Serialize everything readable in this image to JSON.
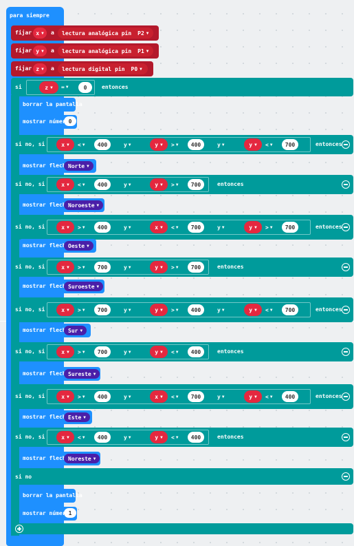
{
  "forever_label": "para siempre",
  "sets": [
    {
      "kw": "fijar",
      "var": "x",
      "to": "a",
      "fn": "lectura analógica pin",
      "pin": "P2"
    },
    {
      "kw": "fijar",
      "var": "y",
      "to": "a",
      "fn": "lectura analógica pin",
      "pin": "P1"
    },
    {
      "kw": "fijar",
      "var": "z",
      "to": "a",
      "fn": "lectura digital pin",
      "pin": "P0"
    }
  ],
  "if_row": {
    "kw": "si",
    "var": "z",
    "op": "=",
    "val": "0",
    "then": "entonces"
  },
  "clear_label": "borrar la pantalla",
  "show_number_label": "mostrar número",
  "show_number_val_1": "0",
  "show_number_val_2": "1",
  "else_if_label": "si no, si",
  "else_label": "si no",
  "and_label": "y",
  "then_label": "entonces",
  "show_arrow_label": "mostrar flecha",
  "arrow_symbol": "▼",
  "branches": [
    {
      "conds": [
        {
          "v": "x",
          "op": "<",
          "n": "400"
        },
        {
          "v": "y",
          "op": ">",
          "n": "400"
        },
        {
          "v": "y",
          "op": "<",
          "n": "700"
        }
      ],
      "arrow": "Norte"
    },
    {
      "conds": [
        {
          "v": "x",
          "op": "<",
          "n": "400"
        },
        {
          "v": "y",
          "op": ">",
          "n": "700"
        }
      ],
      "arrow": "Noroeste"
    },
    {
      "conds": [
        {
          "v": "x",
          "op": ">",
          "n": "400"
        },
        {
          "v": "x",
          "op": "<",
          "n": "700"
        },
        {
          "v": "y",
          "op": ">",
          "n": "700"
        }
      ],
      "arrow": "Oeste"
    },
    {
      "conds": [
        {
          "v": "x",
          "op": ">",
          "n": "700"
        },
        {
          "v": "y",
          "op": ">",
          "n": "700"
        }
      ],
      "arrow": "Suroeste"
    },
    {
      "conds": [
        {
          "v": "x",
          "op": ">",
          "n": "700"
        },
        {
          "v": "y",
          "op": ">",
          "n": "400"
        },
        {
          "v": "y",
          "op": "<",
          "n": "700"
        }
      ],
      "arrow": "Sur"
    },
    {
      "conds": [
        {
          "v": "x",
          "op": ">",
          "n": "700"
        },
        {
          "v": "y",
          "op": "<",
          "n": "400"
        }
      ],
      "arrow": "Sureste"
    },
    {
      "conds": [
        {
          "v": "x",
          "op": ">",
          "n": "400"
        },
        {
          "v": "x",
          "op": "<",
          "n": "700"
        },
        {
          "v": "y",
          "op": "<",
          "n": "400"
        }
      ],
      "arrow": "Este"
    },
    {
      "conds": [
        {
          "v": "x",
          "op": "<",
          "n": "400"
        },
        {
          "v": "y",
          "op": "<",
          "n": "400"
        }
      ],
      "arrow": "Noreste"
    }
  ],
  "colors": {
    "loop": "#1e90ff",
    "logic": "#009b9b",
    "variable": "#e4283f",
    "arrow": "#4a1fa8",
    "workspace": "#eef0f2"
  }
}
